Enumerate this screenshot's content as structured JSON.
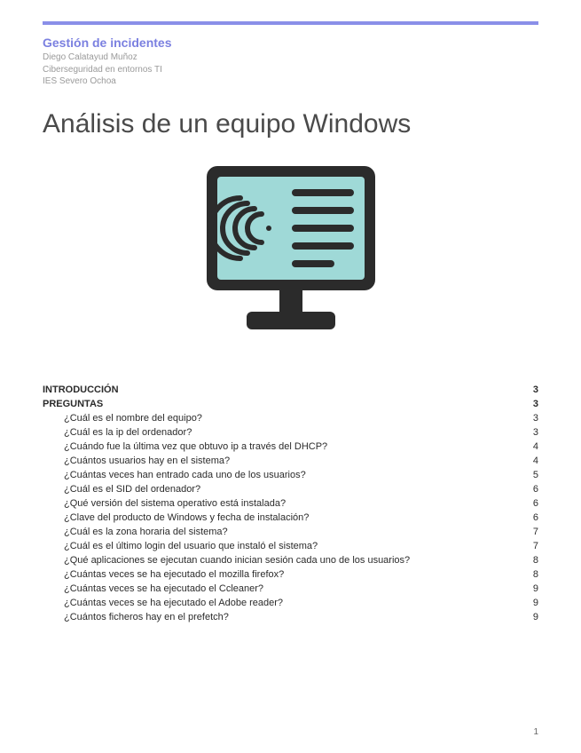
{
  "header": {
    "subject": "Gestión de incidentes",
    "author": "Diego Calatayud Muñoz",
    "course": "Ciberseguridad en entornos TI",
    "school": "IES Severo Ochoa"
  },
  "title": "Análisis de un equipo Windows",
  "toc": {
    "sections": [
      {
        "label": "INTRODUCCIÓN",
        "page": "3"
      },
      {
        "label": "PREGUNTAS",
        "page": "3"
      }
    ],
    "items": [
      {
        "label": "¿Cuál es el nombre del equipo?",
        "page": "3"
      },
      {
        "label": "¿Cuál es la ip del ordenador?",
        "page": "3"
      },
      {
        "label": "¿Cuándo fue la última vez que obtuvo ip a través del DHCP?",
        "page": "4"
      },
      {
        "label": "¿Cuántos usuarios hay en el sistema?",
        "page": "4"
      },
      {
        "label": "¿Cuántas veces han entrado cada uno de los usuarios?",
        "page": "5"
      },
      {
        "label": "¿Cuál es el SID del ordenador?",
        "page": "6"
      },
      {
        "label": "¿Qué versión del sistema operativo está instalada?",
        "page": "6"
      },
      {
        "label": "¿Clave del producto de Windows y fecha de instalación?",
        "page": "6"
      },
      {
        "label": "¿Cuál es la zona horaria del sistema?",
        "page": "7"
      },
      {
        "label": "¿Cuál es el último login del usuario que instaló el sistema?",
        "page": "7"
      },
      {
        "label": "¿Qué aplicaciones se ejecutan cuando inician sesión cada uno de los usuarios?",
        "page": "8"
      },
      {
        "label": "¿Cuántas veces se ha ejecutado el mozilla firefox?",
        "page": "8"
      },
      {
        "label": "¿Cuántas veces se ha ejecutado el Ccleaner?",
        "page": "9"
      },
      {
        "label": "¿Cuántas veces se ha ejecutado el Adobe reader?",
        "page": "9"
      },
      {
        "label": "¿Cuántos ficheros hay en el prefetch?",
        "page": "9"
      }
    ]
  },
  "pageNumber": "1"
}
